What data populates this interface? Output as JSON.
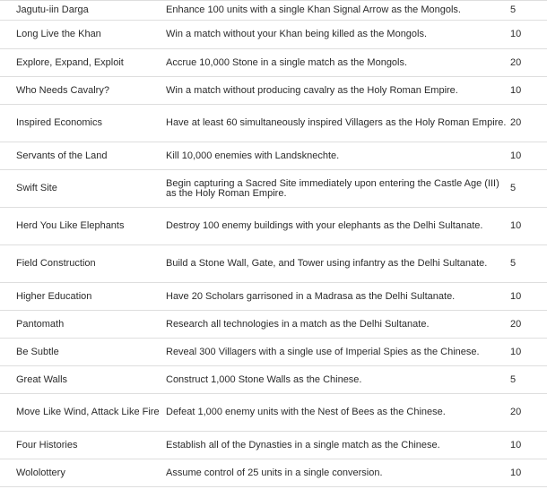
{
  "achievements": [
    {
      "name": "Jagutu-iin Darga",
      "description": "Enhance 100 units with a single Khan Signal Arrow as the Mongols.",
      "points": "5"
    },
    {
      "name": "Long Live the Khan",
      "description": "Win a match without your Khan being killed as the Mongols.",
      "points": "10"
    },
    {
      "name": "Explore, Expand, Exploit",
      "description": "Accrue 10,000 Stone in a single match as the Mongols.",
      "points": "20"
    },
    {
      "name": "Who Needs Cavalry?",
      "description": "Win a match without producing cavalry as the Holy Roman Empire.",
      "points": "10"
    },
    {
      "name": "Inspired Economics",
      "description": "Have at least 60 simultaneously inspired Villagers as the Holy Roman Empire.",
      "points": "20"
    },
    {
      "name": "Servants of the Land",
      "description": "Kill 10,000 enemies with Landsknechte.",
      "points": "10"
    },
    {
      "name": "Swift Site",
      "description": "Begin capturing a Sacred Site immediately upon entering the Castle Age (III) as the Holy Roman Empire.",
      "points": "5"
    },
    {
      "name": "Herd You Like Elephants",
      "description": "Destroy 100 enemy buildings with your elephants as the Delhi Sultanate.",
      "points": "10"
    },
    {
      "name": "Field Construction",
      "description": "Build a Stone Wall, Gate, and Tower using infantry as the Delhi Sultanate.",
      "points": "5"
    },
    {
      "name": "Higher Education",
      "description": "Have 20 Scholars garrisoned in a Madrasa as the Delhi Sultanate.",
      "points": "10"
    },
    {
      "name": "Pantomath",
      "description": "Research all technologies in a match as the Delhi Sultanate.",
      "points": "20"
    },
    {
      "name": "Be Subtle",
      "description": "Reveal 300 Villagers with a single use of Imperial Spies as the Chinese.",
      "points": "10"
    },
    {
      "name": "Great Walls",
      "description": "Construct 1,000 Stone Walls as the Chinese.",
      "points": "5"
    },
    {
      "name": "Move Like Wind, Attack Like Fire",
      "description": "Defeat 1,000 enemy units with the Nest of Bees as the Chinese.",
      "points": "20"
    },
    {
      "name": "Four Histories",
      "description": "Establish all of the Dynasties in a single match as the Chinese.",
      "points": "10"
    },
    {
      "name": "Wololottery",
      "description": "Assume control of 25 units in a single conversion.",
      "points": "10"
    }
  ]
}
